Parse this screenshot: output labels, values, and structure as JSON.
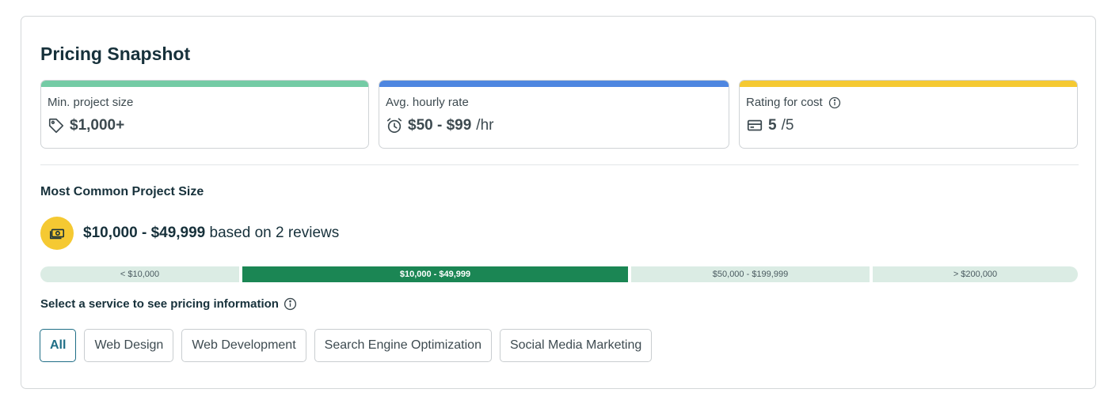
{
  "title": "Pricing Snapshot",
  "stats": [
    {
      "label": "Min. project size",
      "value": "$1,000+",
      "suffix": "",
      "icon": "tag-icon",
      "color": "#74cba5"
    },
    {
      "label": "Avg. hourly rate",
      "value": "$50 - $99",
      "suffix": "/hr",
      "icon": "alarm-clock-icon",
      "color": "#4e86e0"
    },
    {
      "label": "Rating for cost",
      "value": "5",
      "suffix": "/5",
      "icon": "credit-card-icon",
      "info_icon": "info-icon",
      "color": "#f5c932"
    }
  ],
  "common_size": {
    "heading": "Most Common Project Size",
    "range": "$10,000 - $49,999",
    "suffix": "based on 2 reviews",
    "icon": "money-icon"
  },
  "range_bar": {
    "segments": [
      {
        "label": "< $10,000",
        "active": false
      },
      {
        "label": "$10,000 - $49,999",
        "active": true
      },
      {
        "label": "$50,000 - $199,999",
        "active": false
      },
      {
        "label": "> $200,000",
        "active": false
      }
    ],
    "active_color": "#1b8654",
    "inactive_color": "#dbece4"
  },
  "service_filter": {
    "label": "Select a service to see pricing information",
    "info_icon": "info-icon",
    "chips": [
      "All",
      "Web Design",
      "Web Development",
      "Search Engine Optimization",
      "Social Media Marketing"
    ],
    "selected": "All"
  }
}
